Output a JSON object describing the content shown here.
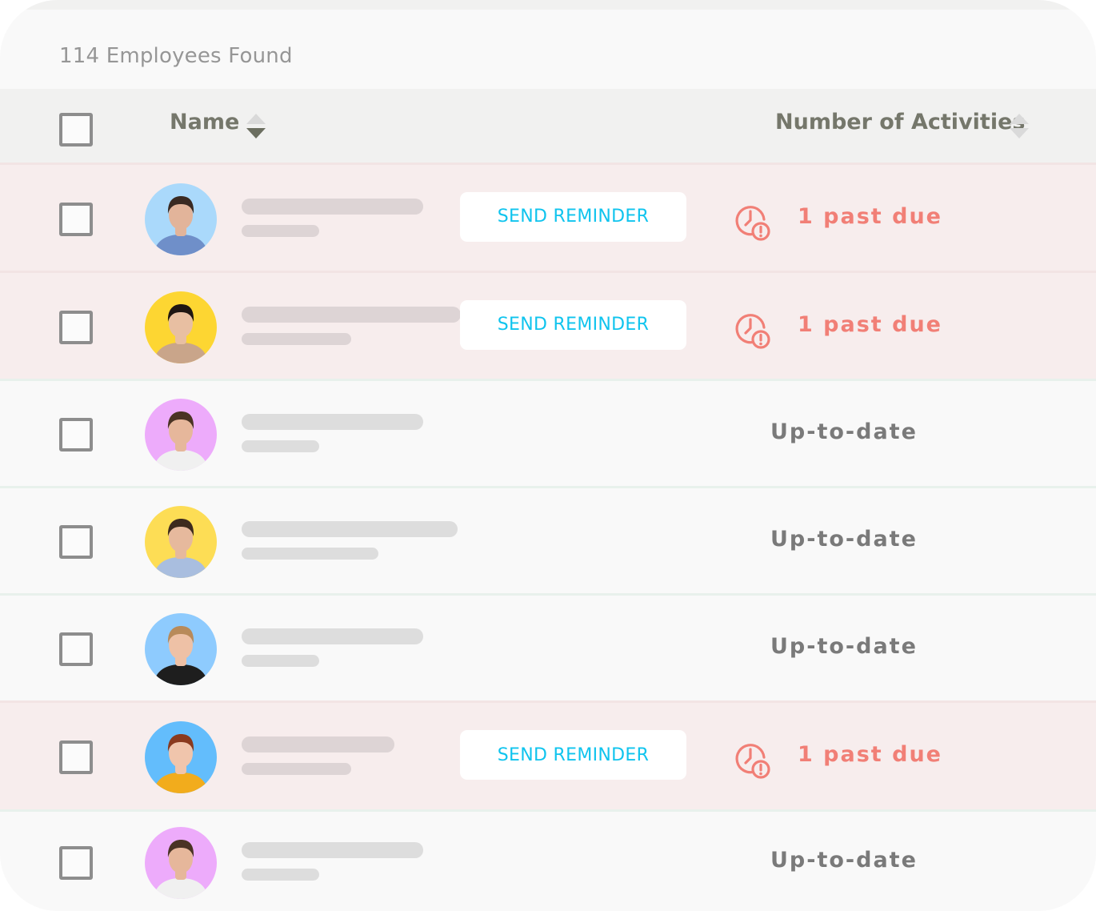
{
  "results": {
    "count_label": "114 Employees Found"
  },
  "table": {
    "columns": {
      "name": "Name",
      "activities": "Number of Activities"
    },
    "colors": {
      "overdue_row_bg": "#f7eded",
      "ok_row_bg": "#f9f9f9",
      "reminder_text": "#10c4ee",
      "past_due": "#f17f76",
      "up_to_date": "#7a7a7a"
    },
    "rows": [
      {
        "status": "overdue",
        "avatar_bg": "#aad9fb",
        "avatar_person": "bearded man in blue shirt",
        "action_label": "SEND REMINDER",
        "status_label": "1 past due"
      },
      {
        "status": "overdue",
        "avatar_bg": "#fdd632",
        "avatar_person": "woman with long dark hair",
        "action_label": "SEND REMINDER",
        "status_label": "1 past due"
      },
      {
        "status": "ok",
        "avatar_bg": "#edabfb",
        "avatar_person": "young man in white t-shirt",
        "status_label": "Up-to-date"
      },
      {
        "status": "ok",
        "avatar_bg": "#fddd55",
        "avatar_person": "bearded man in checkered shirt",
        "status_label": "Up-to-date"
      },
      {
        "status": "ok",
        "avatar_bg": "#8ecbfe",
        "avatar_person": "blond man in black t-shirt",
        "status_label": "Up-to-date"
      },
      {
        "status": "overdue",
        "avatar_bg": "#63bdfc",
        "avatar_person": "red-haired woman in yellow top",
        "action_label": "SEND REMINDER",
        "status_label": "1 past due"
      },
      {
        "status": "ok",
        "avatar_bg": "#edabfb",
        "avatar_person": "young man in white t-shirt",
        "status_label": "Up-to-date"
      }
    ]
  }
}
